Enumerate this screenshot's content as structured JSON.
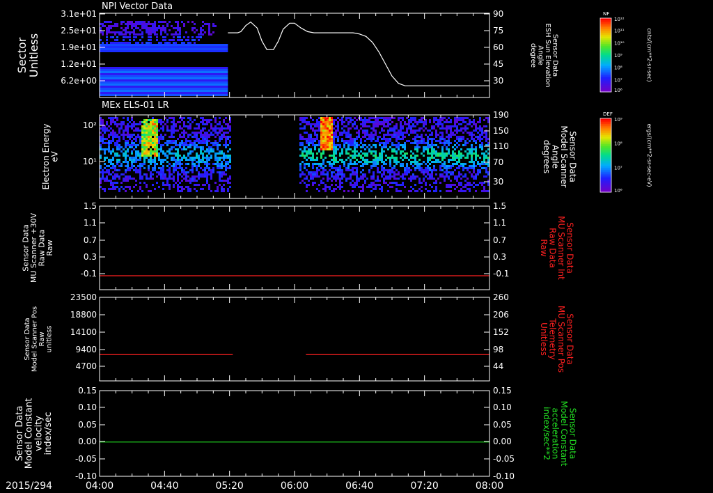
{
  "date_label": "2015/294",
  "x_ticks": [
    "04:00",
    "04:40",
    "05:20",
    "06:00",
    "06:40",
    "07:20",
    "08:00"
  ],
  "colors": {
    "white": "#ffffff",
    "red": "#ff2020",
    "green": "#22dd22",
    "background": "#000000"
  },
  "chart_data": [
    {
      "panel": 1,
      "type": "heatmap",
      "title": "NPI Vector Data",
      "ylabel_left": [
        "Sector",
        "Unitless"
      ],
      "ylabel_right": [
        "Sensor Data",
        "ESH Sun Elevation",
        "Angle",
        "degree"
      ],
      "y_ticks_left": [
        "3.1e+01",
        "2.5e+01",
        "1.9e+01",
        "1.2e+01",
        "6.2e+00"
      ],
      "y_ticks_right": [
        "90",
        "75",
        "60",
        "45",
        "30"
      ],
      "line_x": [
        "04:00",
        "05:25",
        "05:27",
        "05:30",
        "05:33",
        "05:37",
        "05:40",
        "05:43",
        "05:47",
        "05:50",
        "05:53",
        "05:57",
        "06:00",
        "06:04",
        "06:08",
        "06:12",
        "06:16",
        "06:20",
        "06:24",
        "06:28",
        "06:32",
        "06:36",
        "06:40",
        "06:44",
        "06:48",
        "06:52",
        "06:56",
        "07:00",
        "07:04",
        "07:08",
        "07:12",
        "08:00"
      ],
      "line_y": [
        72,
        72,
        73,
        78,
        81,
        76,
        65,
        58,
        58,
        65,
        75,
        80,
        80,
        76,
        73,
        72,
        72,
        72,
        72,
        72,
        72,
        72,
        71,
        69,
        64,
        56,
        46,
        36,
        30,
        28,
        28,
        28
      ],
      "line_ylim": [
        20,
        90
      ],
      "colorbar": {
        "label": "NF",
        "top": "10¹²",
        "ticks": [
          "10¹¹",
          "10¹⁰",
          "10⁹",
          "10⁸",
          "10⁷"
        ],
        "bottom": "10⁶",
        "unit": "cnts/(cm**2-sr-sec)"
      }
    },
    {
      "panel": 2,
      "type": "heatmap",
      "title": "MEx ELS-01 LR",
      "ylabel_left": [
        "Electron Energy",
        "eV"
      ],
      "ylabel_right": [
        "Sensor Data",
        "Model Scanner",
        "Angle",
        "degrees"
      ],
      "y_ticks_left": [
        "10²",
        "10¹"
      ],
      "y_ticks_right": [
        "190",
        "150",
        "110",
        "70",
        "30"
      ],
      "colorbar": {
        "label": "DEF",
        "top": "10⁹",
        "ticks": [
          "10⁸",
          "10⁷"
        ],
        "bottom": "10⁶",
        "unit": "ergs/(cm**2-sr-sec-eV)"
      }
    },
    {
      "panel": 3,
      "type": "line",
      "ylabel_left": [
        "Sensor Data",
        "MU Scanner +30V",
        "Raw Data",
        "Raw"
      ],
      "ylabel_right": [
        "Sensor Data",
        "MU Scanner Int",
        "Raw Data",
        "Raw"
      ],
      "y_ticks_left": [
        "1.5",
        "1.1",
        "0.7",
        "0.3",
        "-0.1"
      ],
      "y_ticks_right": [
        "1.5",
        "1.1",
        "0.7",
        "0.3",
        "-0.1"
      ],
      "ylim": [
        -0.3,
        1.5
      ],
      "series": [
        {
          "x": [
            "04:00",
            "08:00"
          ],
          "y": [
            0,
            0
          ]
        }
      ]
    },
    {
      "panel": 4,
      "type": "line",
      "ylabel_left": [
        "Sensor Data",
        "Model Scanner Pos",
        "Raw",
        "unitless"
      ],
      "ylabel_right": [
        "Sensor Data",
        "MU Scanner Pos",
        "Telemetry",
        "Unitless"
      ],
      "y_ticks_left": [
        "23500",
        "18800",
        "14100",
        "9400",
        "4700"
      ],
      "y_ticks_right": [
        "260",
        "206",
        "152",
        "98",
        "44"
      ],
      "ylim": [
        0,
        23500
      ],
      "series": [
        {
          "x": [
            "04:00",
            "05:22"
          ],
          "y": [
            7400,
            7400
          ]
        },
        {
          "x": [
            "06:07",
            "08:00"
          ],
          "y": [
            7400,
            7400
          ]
        }
      ]
    },
    {
      "panel": 5,
      "type": "line",
      "ylabel_left": [
        "Sensor Data",
        "Model Constant",
        "velocity",
        "index/sec"
      ],
      "ylabel_right": [
        "Sensor Data",
        "Model Constant",
        "acceleration",
        "index/sec**2"
      ],
      "y_ticks_left": [
        "0.15",
        "0.10",
        "0.05",
        "0.00",
        "-0.05",
        "-0.10"
      ],
      "y_ticks_right": [
        "0.15",
        "0.10",
        "0.05",
        "0.00",
        "-0.05",
        "-0.10"
      ],
      "ylim": [
        -0.1,
        0.15
      ],
      "series": [
        {
          "x": [
            "04:00",
            "08:00"
          ],
          "y": [
            0,
            0
          ]
        }
      ]
    }
  ]
}
